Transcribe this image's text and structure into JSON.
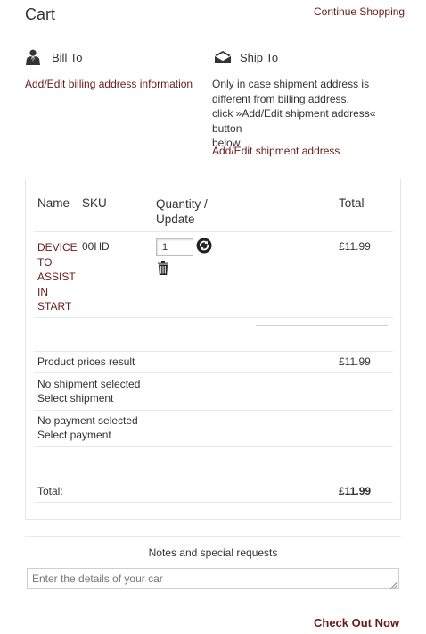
{
  "header": {
    "title": "Cart",
    "continue_label": "Continue Shopping"
  },
  "billing": {
    "title": "Bill To",
    "link": "Add/Edit billing address information"
  },
  "shipping": {
    "title": "Ship To",
    "info_lines": [
      "Only in case shipment address is",
      "different from billing address,",
      "click »Add/Edit shipment address« button",
      "below"
    ],
    "link": "Add/Edit shipment address"
  },
  "table": {
    "headers": {
      "name": "Name",
      "sku": "SKU",
      "quantity_line1": "Quantity /",
      "quantity_line2": "Update",
      "total": "Total"
    },
    "rows": [
      {
        "name_lines": [
          "DEVICE",
          "TO",
          "ASSIST",
          "IN",
          "START"
        ],
        "sku": "00HD",
        "quantity": "1",
        "total": "£11.99"
      }
    ],
    "product_prices_label": "Product prices result",
    "product_prices_value": "£11.99",
    "shipment_status": "No shipment selected",
    "shipment_link": "Select shipment",
    "payment_status": "No payment selected",
    "payment_link": "Select payment",
    "total_label": "Total:",
    "total_value": "£11.99"
  },
  "notes": {
    "label": "Notes and special requests",
    "placeholder": "Enter the details of your car"
  },
  "checkout_label": "Check Out Now",
  "colors": {
    "link": "#6b1a1a",
    "text": "#333333",
    "border": "#e6e6e6"
  },
  "icons": {
    "bill": "person-icon",
    "ship": "envelope-icon",
    "refresh": "refresh-icon",
    "delete": "trash-icon"
  }
}
